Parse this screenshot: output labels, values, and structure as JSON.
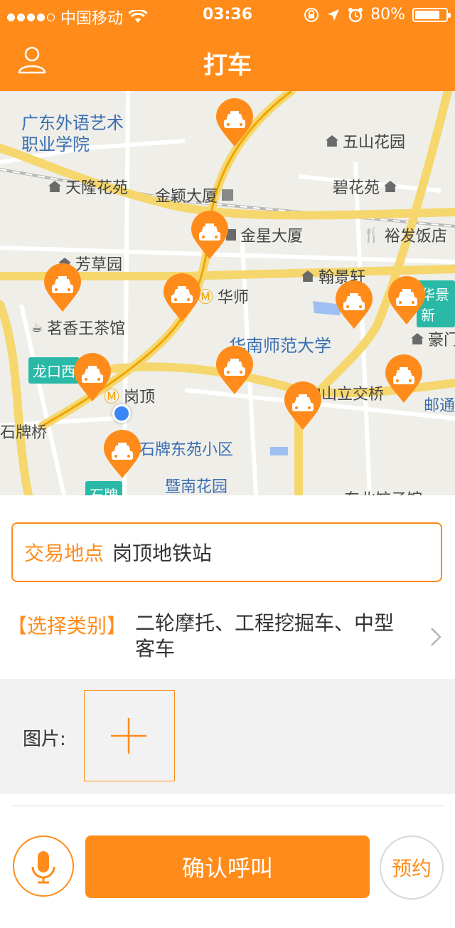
{
  "status_bar": {
    "carrier": "中国移动",
    "time": "03:36",
    "battery": "80%",
    "battery_level": 0.8
  },
  "header": {
    "title": "打车"
  },
  "map": {
    "labels": {
      "guangdong_school": "广东外语艺术\n职业学院",
      "tianlong": "天隆花苑",
      "jinying": "金颖大厦",
      "jinxing": "金星大厦",
      "wushan": "五山花园",
      "bihua": "碧花苑",
      "yufa": "裕发饭店",
      "fangcao": "芳草园",
      "hanjing": "翰景轩",
      "huashi": "华师",
      "huajing": "华景新",
      "mingxiang": "茗香王茶馆",
      "scnu": "华南师范大学",
      "haomen": "豪门",
      "longkou": "龙口西",
      "gangding": "岗顶",
      "zhongshan": "中山立交桥",
      "youtong": "邮通",
      "shipaiqiao": "石牌桥",
      "shipaidong": "石牌东苑小区",
      "jinan": "暨南花园",
      "shipai": "石牌",
      "dongbei": "东北饺子馆"
    }
  },
  "form": {
    "address_label": "交易地点",
    "address_value": "岗顶地铁站",
    "category_label": "【选择类别】",
    "category_value": "二轮摩托、工程挖掘车、中型客车",
    "photo_label": "图片:"
  },
  "actions": {
    "confirm": "确认呼叫",
    "reserve": "预约"
  },
  "colors": {
    "accent": "#ff8c1a",
    "metro": "#2ab9a6",
    "location": "#3b86f7"
  }
}
